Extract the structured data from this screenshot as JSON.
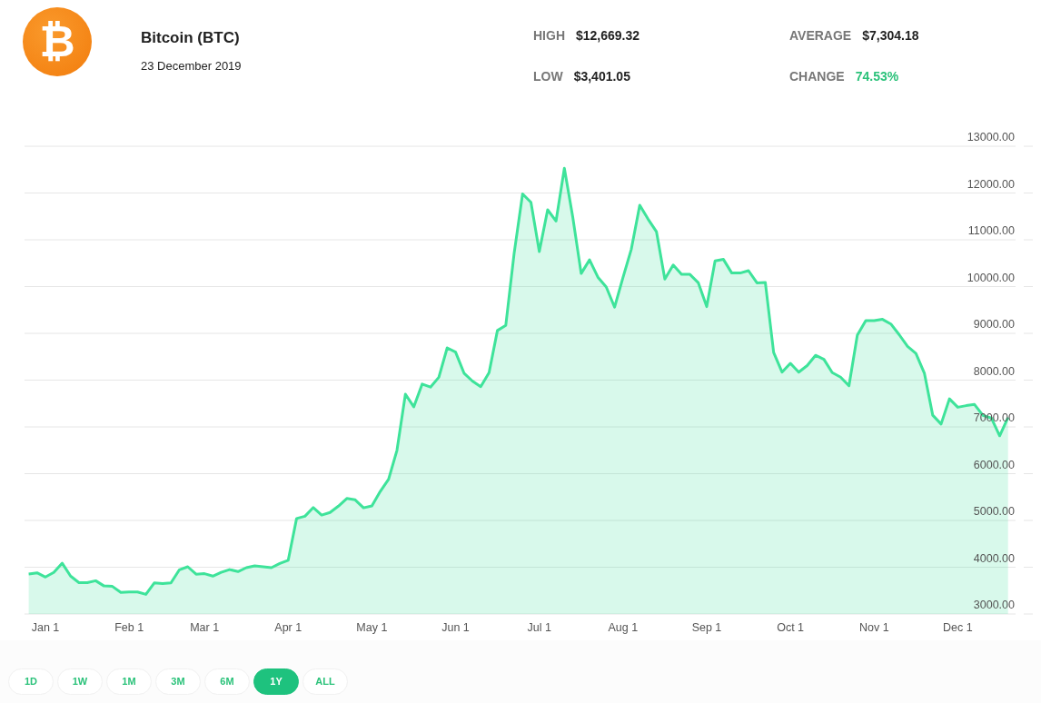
{
  "coin": {
    "logo_symbol": "₿",
    "name": "Bitcoin (BTC)",
    "date": "23 December 2019"
  },
  "stats": [
    {
      "label": "HIGH",
      "value": "$12,669.32",
      "kind": "plain"
    },
    {
      "label": "AVERAGE",
      "value": "$7,304.18",
      "kind": "plain"
    },
    {
      "label": "LOW",
      "value": "$3,401.05",
      "kind": "plain"
    },
    {
      "label": "CHANGE",
      "value": "74.53%",
      "kind": "gain"
    }
  ],
  "chart_data": {
    "type": "area",
    "grid": true,
    "categories": [
      null,
      null,
      "Jan 1",
      null,
      null,
      null,
      null,
      null,
      null,
      null,
      null,
      null,
      "Feb 1",
      null,
      null,
      null,
      null,
      null,
      null,
      null,
      null,
      "Mar 1",
      null,
      null,
      null,
      null,
      null,
      null,
      null,
      null,
      null,
      "Apr 1",
      null,
      null,
      null,
      null,
      null,
      null,
      null,
      null,
      null,
      "May 1",
      null,
      null,
      null,
      null,
      null,
      null,
      null,
      null,
      null,
      "Jun 1",
      null,
      null,
      null,
      null,
      null,
      null,
      null,
      null,
      null,
      "Jul 1",
      null,
      null,
      null,
      null,
      null,
      null,
      null,
      null,
      null,
      "Aug 1",
      null,
      null,
      null,
      null,
      null,
      null,
      null,
      null,
      null,
      "Sep 1",
      null,
      null,
      null,
      null,
      null,
      null,
      null,
      null,
      null,
      "Oct 1",
      null,
      null,
      null,
      null,
      null,
      null,
      null,
      null,
      null,
      "Nov 1",
      null,
      null,
      null,
      null,
      null,
      null,
      null,
      null,
      null,
      "Dec 1",
      null,
      null,
      null,
      null,
      null,
      null
    ],
    "series": [
      {
        "color": "#3ee39a",
        "values": [
          3855,
          3880,
          3790,
          3890,
          4085,
          3810,
          3670,
          3670,
          3710,
          3600,
          3590,
          3460,
          3470,
          3470,
          3420,
          3665,
          3648,
          3665,
          3945,
          4010,
          3850,
          3862,
          3810,
          3890,
          3950,
          3907,
          3990,
          4030,
          4010,
          3990,
          4080,
          4150,
          5040,
          5090,
          5275,
          5115,
          5170,
          5305,
          5470,
          5440,
          5270,
          5310,
          5620,
          5880,
          6500,
          7700,
          7430,
          7915,
          7850,
          8060,
          8690,
          8600,
          8150,
          7980,
          7860,
          8160,
          9060,
          9170,
          10710,
          11980,
          11800,
          10750,
          11640,
          11400,
          12530,
          11490,
          10280,
          10570,
          10200,
          9990,
          9560,
          10190,
          10800,
          11740,
          11440,
          11170,
          10160,
          10460,
          10260,
          10260,
          10080,
          9570,
          10550,
          10580,
          10290,
          10290,
          10340,
          10080,
          10090,
          8590,
          8170,
          8360,
          8170,
          8310,
          8530,
          8445,
          8160,
          8065,
          7880,
          8960,
          9270,
          9270,
          9300,
          9200,
          8970,
          8720,
          8570,
          8150,
          7250,
          7060,
          7600,
          7420,
          7455,
          7480,
          7245,
          7190,
          6810,
          7200
        ]
      }
    ],
    "ylim": [
      3000,
      13000
    ],
    "yticks": [
      {
        "value": 3000,
        "label": "3000.00"
      },
      {
        "value": 4000,
        "label": "4000.00"
      },
      {
        "value": 5000,
        "label": "5000.00"
      },
      {
        "value": 6000,
        "label": "6000.00"
      },
      {
        "value": 7000,
        "label": "7000.00"
      },
      {
        "value": 8000,
        "label": "8000.00"
      },
      {
        "value": 9000,
        "label": "9000.00"
      },
      {
        "value": 10000,
        "label": "10000.00"
      },
      {
        "value": 11000,
        "label": "11000.00"
      },
      {
        "value": 12000,
        "label": "12000.00"
      },
      {
        "value": 13000,
        "label": "13000.00"
      }
    ]
  },
  "ranges": [
    {
      "label": "1D",
      "selected": false
    },
    {
      "label": "1W",
      "selected": false
    },
    {
      "label": "1M",
      "selected": false
    },
    {
      "label": "3M",
      "selected": false
    },
    {
      "label": "6M",
      "selected": false
    },
    {
      "label": "1Y",
      "selected": true
    },
    {
      "label": "ALL",
      "selected": false
    }
  ]
}
